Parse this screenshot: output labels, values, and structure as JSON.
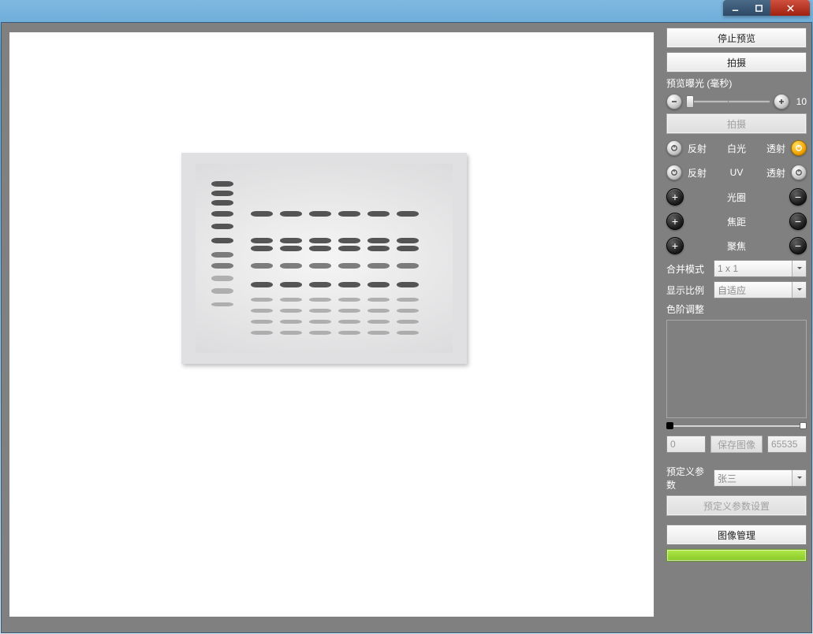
{
  "titlebar": {
    "minimize_icon": "minimize",
    "maximize_icon": "maximize",
    "close_icon": "close"
  },
  "sidebar": {
    "stop_preview": "停止预览",
    "capture": "拍摄",
    "exposure_label": "预览曝光 (毫秒)",
    "exposure_value": "10",
    "capture_disabled": "拍摄",
    "light1": {
      "left": "反射",
      "mid": "白光",
      "right": "透射"
    },
    "light2": {
      "left": "反射",
      "mid": "UV",
      "right": "透射"
    },
    "aperture": "光圈",
    "focal": "焦距",
    "focus": "聚焦",
    "merge_mode_label": "合并模式",
    "merge_mode_value": "1 x 1",
    "display_ratio_label": "显示比例",
    "display_ratio_value": "自适应",
    "levels_label": "色阶调整",
    "range_low": "0",
    "range_high": "65535",
    "save_image": "保存图像",
    "preset_label": "预定义参数",
    "preset_value": "张三",
    "preset_settings": "预定义参数设置",
    "image_manage": "图像管理"
  }
}
